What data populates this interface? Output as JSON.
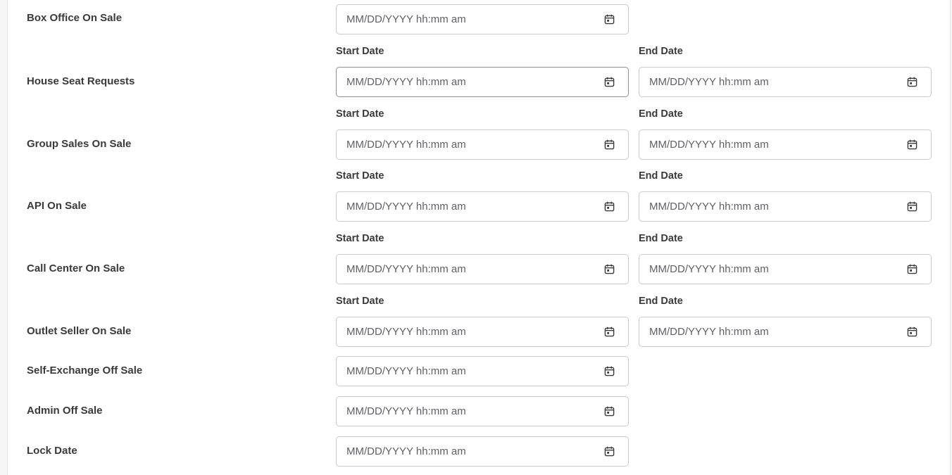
{
  "rows": [
    {
      "label": "Box Office On Sale",
      "start_placeholder": "MM/DD/YYYY hh:mm am"
    },
    {
      "label": "House Seat Requests",
      "start_label": "Start Date",
      "end_label": "End Date",
      "start_placeholder": "MM/DD/YYYY hh:mm am",
      "end_placeholder": "MM/DD/YYYY hh:mm am"
    },
    {
      "label": "Group Sales On Sale",
      "start_label": "Start Date",
      "end_label": "End Date",
      "start_placeholder": "MM/DD/YYYY hh:mm am",
      "end_placeholder": "MM/DD/YYYY hh:mm am"
    },
    {
      "label": "API On Sale",
      "start_label": "Start Date",
      "end_label": "End Date",
      "start_placeholder": "MM/DD/YYYY hh:mm am",
      "end_placeholder": "MM/DD/YYYY hh:mm am"
    },
    {
      "label": "Call Center On Sale",
      "start_label": "Start Date",
      "end_label": "End Date",
      "start_placeholder": "MM/DD/YYYY hh:mm am",
      "end_placeholder": "MM/DD/YYYY hh:mm am"
    },
    {
      "label": "Outlet Seller On Sale",
      "start_label": "Start Date",
      "end_label": "End Date",
      "start_placeholder": "MM/DD/YYYY hh:mm am",
      "end_placeholder": "MM/DD/YYYY hh:mm am"
    },
    {
      "label": "Self-Exchange Off Sale",
      "start_placeholder": "MM/DD/YYYY hh:mm am"
    },
    {
      "label": "Admin Off Sale",
      "start_placeholder": "MM/DD/YYYY hh:mm am"
    },
    {
      "label": "Lock Date",
      "start_placeholder": "MM/DD/YYYY hh:mm am"
    }
  ],
  "icons": {
    "calendar": "calendar-icon"
  },
  "colors": {
    "border": "#c9c9cf",
    "label": "#3a3a3a",
    "placeholder": "#5f5f66",
    "icon": "#3a3a3a"
  }
}
